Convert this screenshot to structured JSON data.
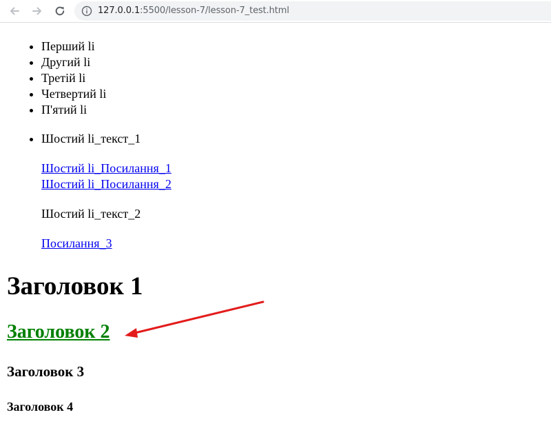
{
  "browser": {
    "url_host": "127.0.0.1",
    "url_rest": ":5500/lesson-7/lesson-7_test.html"
  },
  "page": {
    "list1": [
      "Перший li",
      "Другий li",
      "Третій li",
      "Четвертий li",
      "П'ятий li"
    ],
    "sixth_text_1": "Шостий li_текст_1",
    "sixth_link_1": "Шостий li_Посилання_1",
    "sixth_link_2": "Шостий li_Посилання_2",
    "sixth_text_2": "Шостий li_текст_2",
    "link_3": "Посилання_3",
    "heading_1": "Заголовок 1",
    "heading_2": "Заголовок 2",
    "heading_3": "Заголовок 3",
    "heading_4": "Заголовок 4"
  },
  "annotation": {
    "arrow_color": "#e31b1b"
  },
  "colors": {
    "link": "#0000ee",
    "heading_2": "#008000"
  }
}
